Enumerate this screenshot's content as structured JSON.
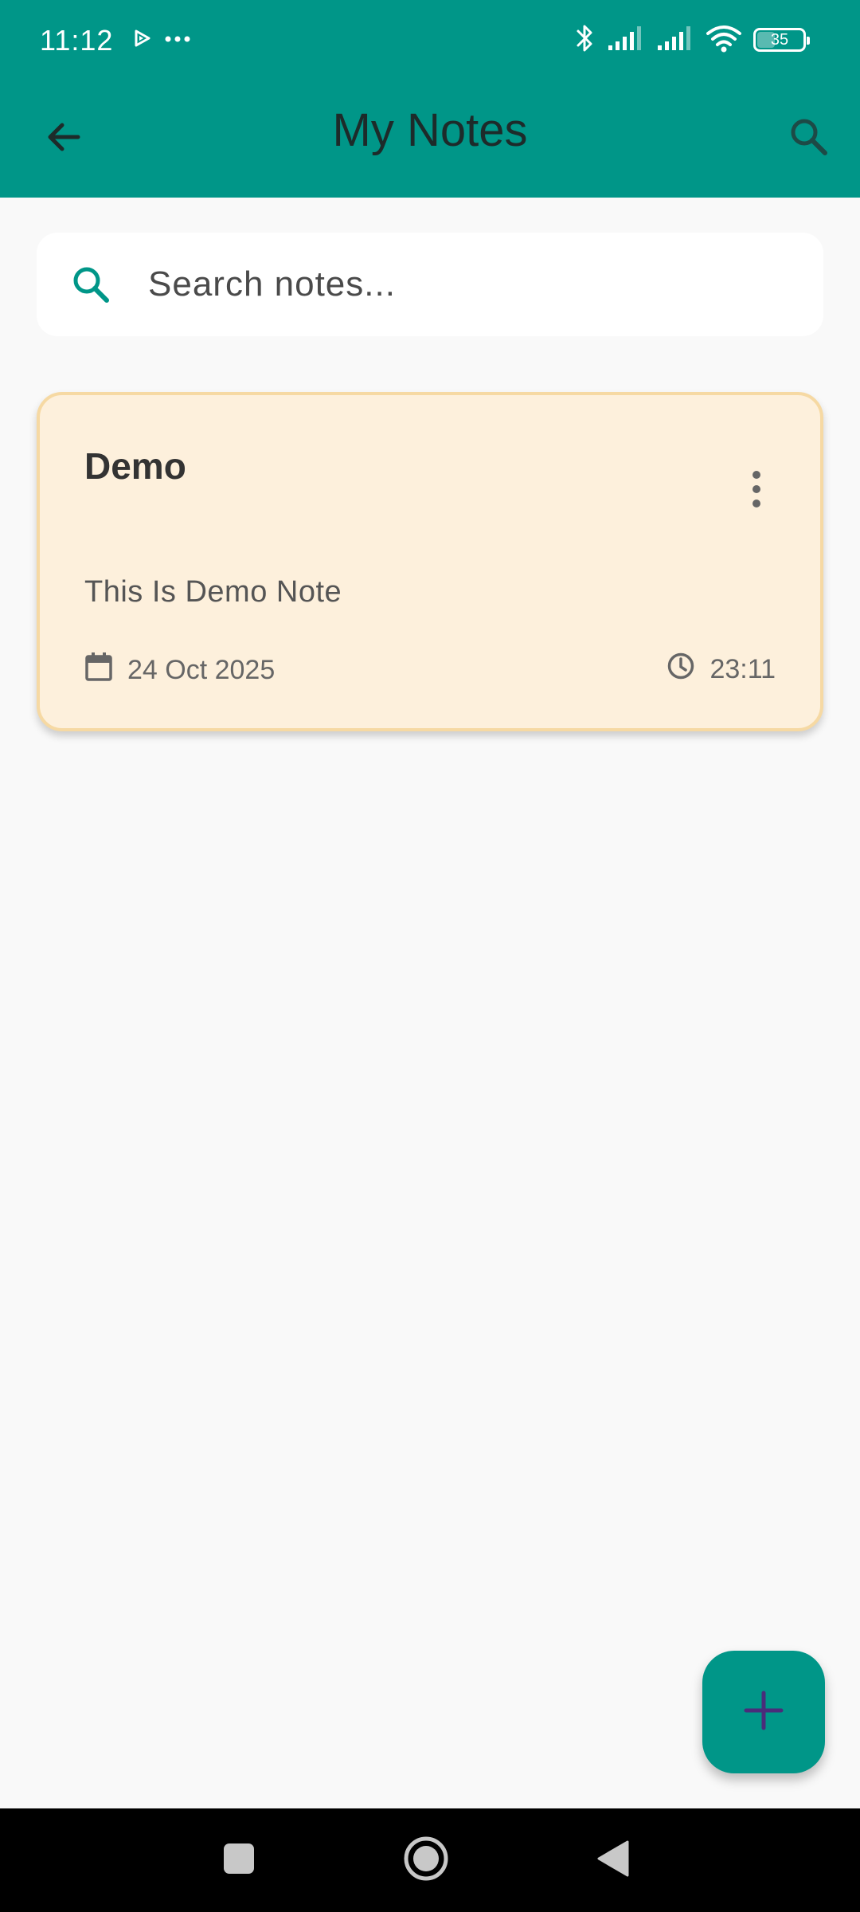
{
  "status_bar": {
    "time": "11:12",
    "battery_level": "35",
    "icons": [
      "media-play-icon",
      "more-dots-icon",
      "bluetooth-icon",
      "signal-icon",
      "signal-icon",
      "wifi-icon",
      "battery-icon"
    ]
  },
  "app_bar": {
    "title": "My Notes",
    "back_icon": "arrow-back-icon",
    "search_icon": "search-icon"
  },
  "search": {
    "placeholder": "Search notes...",
    "value": ""
  },
  "notes": [
    {
      "title": "Demo",
      "body": "This Is Demo Note",
      "date": "24 Oct 2025",
      "time": "23:11",
      "color": "#fdf0dc"
    }
  ],
  "fab": {
    "icon": "plus-icon"
  },
  "nav_bar": {
    "buttons": [
      "recents-square-icon",
      "home-circle-icon",
      "back-triangle-icon"
    ]
  },
  "colors": {
    "primary": "#009688",
    "note_card": "#fdf0dc",
    "note_border": "#f6d9a3",
    "background": "#f9f9f9"
  }
}
